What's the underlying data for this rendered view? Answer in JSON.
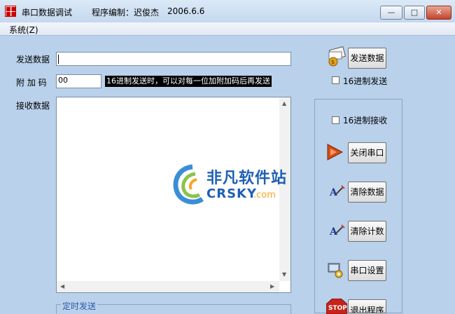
{
  "window": {
    "title": "串口数据调试",
    "subtitle": "程序编制：迟俊杰",
    "date": "2006.6.6",
    "minimize_glyph": "—",
    "maximize_glyph": "□",
    "close_glyph": "✕"
  },
  "menu": {
    "system": "系统(Z)"
  },
  "form": {
    "send_label": "发送数据",
    "send_value": "",
    "checksum_label": "附 加 码",
    "checksum_value": "00",
    "hint": "16进制发送时，可以对每一位加附加码后再发送",
    "receive_label": "接收数据"
  },
  "buttons": {
    "send": "发送数据",
    "hex_send": "16进制发送",
    "hex_receive": "16进制接收",
    "close_port": "关闭串口",
    "clear_data": "清除数据",
    "clear_count": "清除计数",
    "port_settings": "串口设置",
    "exit": "退出程序"
  },
  "checkboxes": {
    "hex_send_checked": false,
    "hex_receive_checked": false
  },
  "timer": {
    "legend": "定时发送"
  },
  "watermark": {
    "line1": "非凡软件站",
    "line2": "CRSKY",
    "line3": ".com"
  },
  "icons": {
    "app": "app-icon",
    "send": "send-data-icon",
    "close_port": "play-arrow-icon",
    "clear_data": "clear-icon",
    "clear_count": "clear-icon",
    "port_settings": "settings-icon",
    "exit": "stop-sign-icon"
  },
  "colors": {
    "background": "#b9d1ea",
    "watermark_blue": "#1f5fb5",
    "watermark_orange": "#f5a623"
  }
}
